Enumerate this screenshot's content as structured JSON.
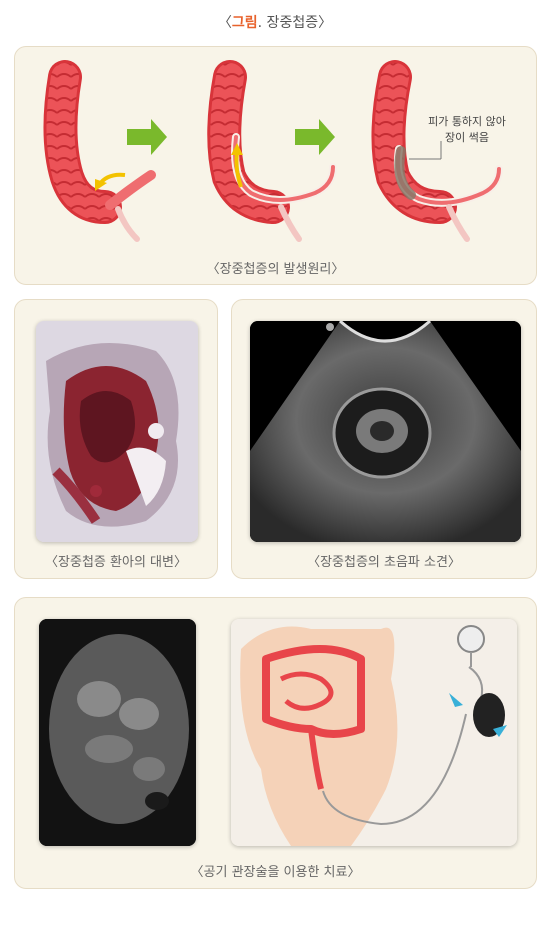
{
  "figure": {
    "title_prefix": "〈",
    "title_accent": "그림",
    "title_dot": ".",
    "title_text": " 장중첩증",
    "title_suffix": "〉"
  },
  "panel1": {
    "annotation_line1": "피가 통하지 않아",
    "annotation_line2": "장이 썩음",
    "caption": "〈장중첩증의 발생원리〉"
  },
  "panel2": {
    "stool_caption": "〈장중첩증 환아의  대변〉",
    "ultrasound_caption": "〈장중첩증의 초음파 소견〉"
  },
  "panel3": {
    "caption": "〈공기 관장술을 이용한 치료〉"
  },
  "colors": {
    "accent": "#e8622c",
    "panel_bg": "#f8f4e8",
    "intestine": "#e8454a",
    "arrow_green": "#7ab92c",
    "arrow_yellow": "#f3c200"
  }
}
